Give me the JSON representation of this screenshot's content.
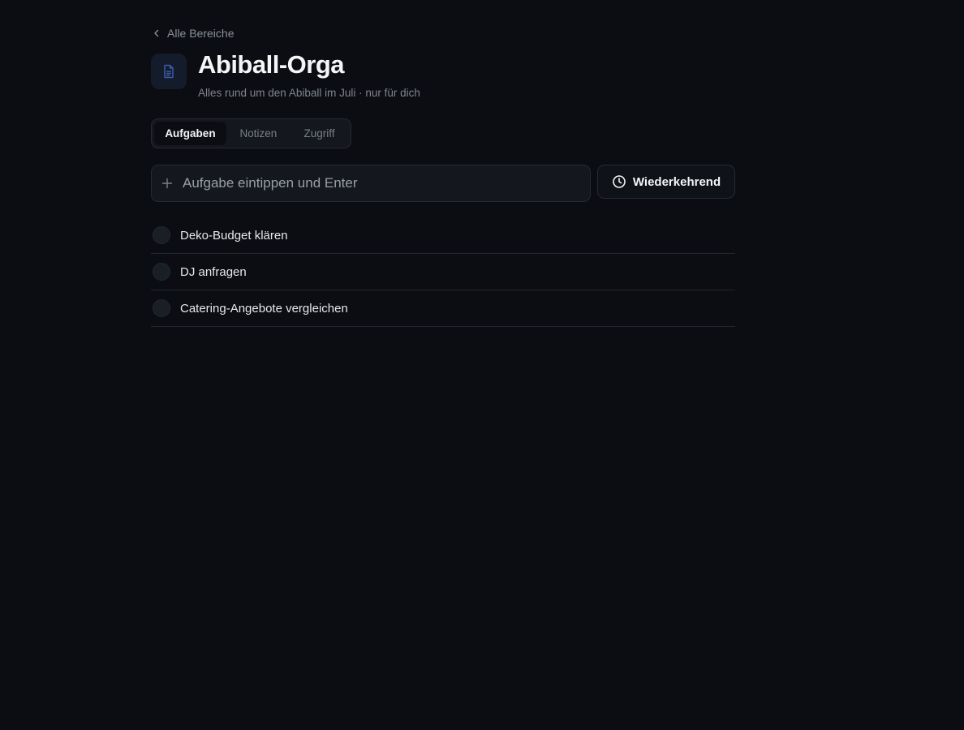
{
  "nav": {
    "back_label": "Alle Bereiche"
  },
  "header": {
    "title": "Abiball-Orga",
    "subtitle": "Alles rund um den Abiball im Juli · nur für dich",
    "icon": "document-icon"
  },
  "tabs": [
    {
      "label": "Aufgaben",
      "active": true
    },
    {
      "label": "Notizen",
      "active": false
    },
    {
      "label": "Zugriff",
      "active": false
    }
  ],
  "task_input": {
    "placeholder": "Aufgabe eintippen und Enter",
    "value": ""
  },
  "recurring_button": {
    "label": "Wiederkehrend",
    "icon": "clock-icon"
  },
  "tasks": [
    {
      "label": "Deko-Budget klären",
      "done": false
    },
    {
      "label": "DJ anfragen",
      "done": false
    },
    {
      "label": "Catering-Angebote vergleichen",
      "done": false
    }
  ],
  "colors": {
    "background": "#0b0d12",
    "surface": "#14171d",
    "border": "#262a32",
    "accent_icon": "#3b5ba8",
    "text_primary": "#f4f5f7",
    "text_muted": "#80858e"
  }
}
